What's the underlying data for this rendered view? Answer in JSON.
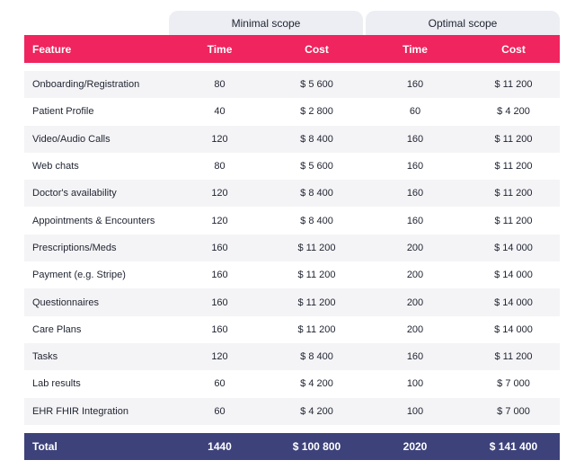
{
  "groups": {
    "minimal": "Minimal scope",
    "optimal": "Optimal scope"
  },
  "header": {
    "feature": "Feature",
    "time_min": "Time",
    "cost_min": "Cost",
    "time_opt": "Time",
    "cost_opt": "Cost"
  },
  "rows": [
    {
      "feature": "Onboarding/Registration",
      "time_min": "80",
      "cost_min": "$ 5 600",
      "time_opt": "160",
      "cost_opt": "$ 11 200"
    },
    {
      "feature": "Patient Profile",
      "time_min": "40",
      "cost_min": "$ 2 800",
      "time_opt": "60",
      "cost_opt": "$ 4 200"
    },
    {
      "feature": "Video/Audio Calls",
      "time_min": "120",
      "cost_min": "$ 8 400",
      "time_opt": "160",
      "cost_opt": "$ 11 200"
    },
    {
      "feature": "Web chats",
      "time_min": "80",
      "cost_min": "$ 5 600",
      "time_opt": "160",
      "cost_opt": "$ 11 200"
    },
    {
      "feature": "Doctor's availability",
      "time_min": "120",
      "cost_min": "$ 8 400",
      "time_opt": "160",
      "cost_opt": "$ 11 200"
    },
    {
      "feature": "Appointments & Encounters",
      "time_min": "120",
      "cost_min": "$ 8 400",
      "time_opt": "160",
      "cost_opt": "$ 11 200"
    },
    {
      "feature": "Prescriptions/Meds",
      "time_min": "160",
      "cost_min": "$ 11 200",
      "time_opt": "200",
      "cost_opt": "$ 14 000"
    },
    {
      "feature": "Payment (e.g. Stripe)",
      "time_min": "160",
      "cost_min": "$ 11 200",
      "time_opt": "200",
      "cost_opt": "$ 14 000"
    },
    {
      "feature": "Questionnaires",
      "time_min": "160",
      "cost_min": "$ 11 200",
      "time_opt": "200",
      "cost_opt": "$ 14 000"
    },
    {
      "feature": "Care Plans",
      "time_min": "160",
      "cost_min": "$ 11 200",
      "time_opt": "200",
      "cost_opt": "$ 14 000"
    },
    {
      "feature": "Tasks",
      "time_min": "120",
      "cost_min": "$ 8 400",
      "time_opt": "160",
      "cost_opt": "$ 11 200"
    },
    {
      "feature": "Lab results",
      "time_min": "60",
      "cost_min": "$ 4 200",
      "time_opt": "100",
      "cost_opt": "$ 7 000"
    },
    {
      "feature": "EHR FHIR Integration",
      "time_min": "60",
      "cost_min": "$ 4 200",
      "time_opt": "100",
      "cost_opt": "$ 7 000"
    }
  ],
  "total": {
    "label": "Total",
    "time_min": "1440",
    "cost_min": "$ 100 800",
    "time_opt": "2020",
    "cost_opt": "$ 141 400"
  },
  "colors": {
    "header": "#f0245e",
    "total": "#3d427a",
    "group_tab": "#eceef3",
    "row_alt": "#f4f4f6"
  }
}
